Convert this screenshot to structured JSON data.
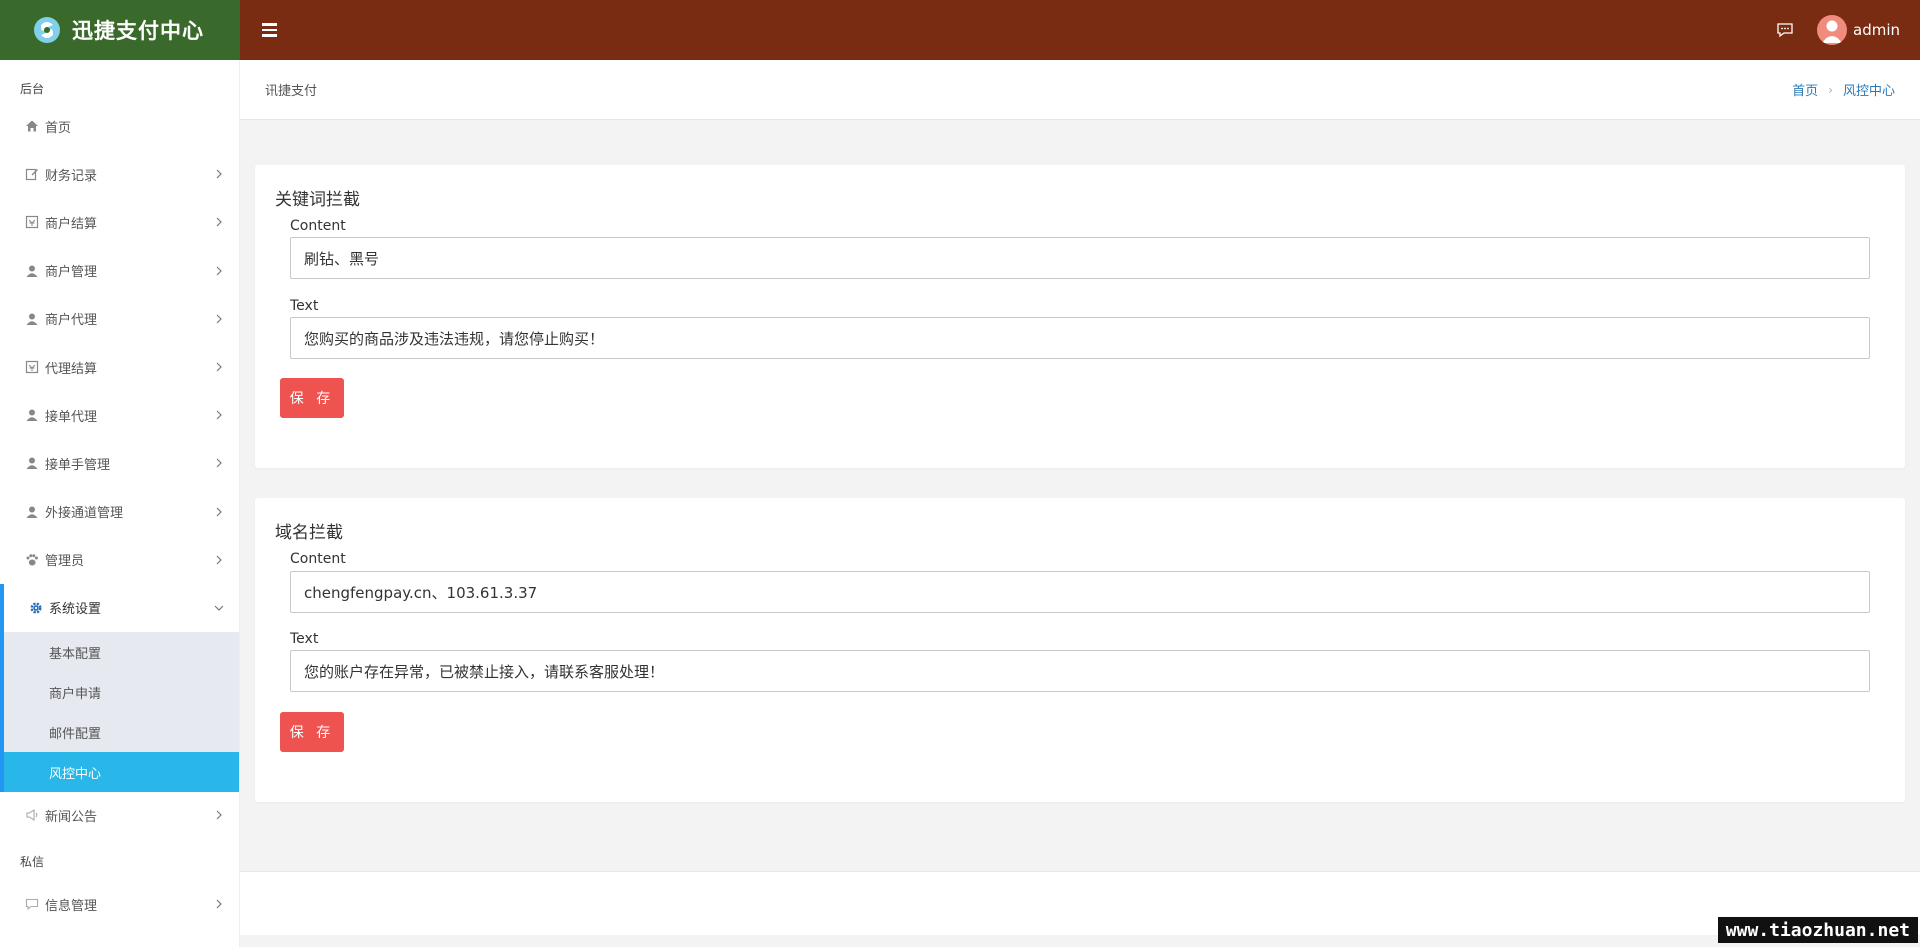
{
  "app": {
    "title": "迅捷支付中心",
    "username": "admin"
  },
  "colors": {
    "logo_bg": "#3a6a2b",
    "topbar_bg": "#7a2c12",
    "active_item": "#29b6e8",
    "save_button": "#ef5350",
    "link": "#2a7ab8"
  },
  "sidebar": {
    "section_backend": "后台",
    "section_private": "私信",
    "items": [
      {
        "label": "首页",
        "icon": "home-icon"
      },
      {
        "label": "财务记录",
        "icon": "edit-icon"
      },
      {
        "label": "商户结算",
        "icon": "ledger-icon"
      },
      {
        "label": "商户管理",
        "icon": "user-icon"
      },
      {
        "label": "商户代理",
        "icon": "user-icon"
      },
      {
        "label": "代理结算",
        "icon": "ledger-icon"
      },
      {
        "label": "接单代理",
        "icon": "user-icon"
      },
      {
        "label": "接单手管理",
        "icon": "user-icon"
      },
      {
        "label": "外接通道管理",
        "icon": "user-icon"
      },
      {
        "label": "管理员",
        "icon": "paw-icon"
      },
      {
        "label": "系统设置",
        "icon": "gear-icon"
      },
      {
        "label": "新闻公告",
        "icon": "speaker-icon"
      },
      {
        "label": "信息管理",
        "icon": "message-icon"
      }
    ],
    "submenu": [
      {
        "label": "基本配置"
      },
      {
        "label": "商户申请"
      },
      {
        "label": "邮件配置"
      },
      {
        "label": "风控中心"
      }
    ]
  },
  "breadcrumb": {
    "title": "讯捷支付",
    "home": "首页",
    "current": "风控中心"
  },
  "keyword_block": {
    "title": "关键词拦截",
    "content_label": "Content",
    "content_value": "刷钻、黑号",
    "text_label": "Text",
    "text_value": "您购买的商品涉及违法违规，请您停止购买！",
    "save_label": "保 存"
  },
  "domain_block": {
    "title": "域名拦截",
    "content_label": "Content",
    "content_value": "chengfengpay.cn、103.61.3.37",
    "text_label": "Text",
    "text_value": "您的账户存在异常，已被禁止接入，请联系客服处理！",
    "save_label": "保 存"
  },
  "watermark": "www.tiaozhuan.net"
}
